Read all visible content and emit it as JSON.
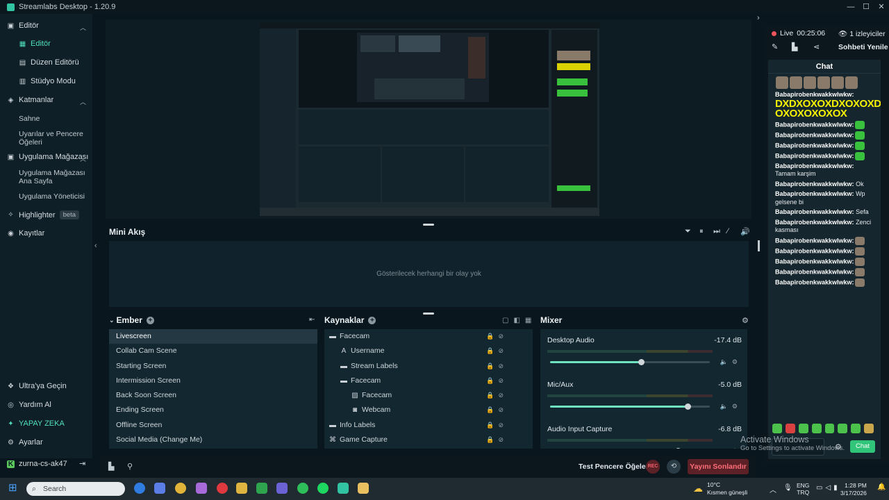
{
  "window": {
    "title": "Streamlabs Desktop - 1.20.9"
  },
  "sidebar": {
    "sections": [
      {
        "label": "Editör"
      },
      {
        "label": "Katmanlar"
      },
      {
        "label": "Uygulama Mağazası"
      }
    ],
    "items": [
      {
        "label": "Editör"
      },
      {
        "label": "Düzen Editörü"
      },
      {
        "label": "Stüdyo Modu"
      },
      {
        "label": "Sahne"
      },
      {
        "label": "Uyarılar ve Pencere Öğeleri"
      },
      {
        "label": "Uygulama Mağazası Ana Sayfa"
      },
      {
        "label": "Uygulama Yöneticisi"
      }
    ],
    "highlighter": {
      "label": "Highlighter",
      "badge": "beta"
    },
    "recordings": "Kayıtlar",
    "bottom": [
      {
        "label": "Ultra'ya Geçin"
      },
      {
        "label": "Yardım Al"
      },
      {
        "label": "YAPAY ZEKA"
      },
      {
        "label": "Ayarlar"
      }
    ],
    "user": "zurna-cs-ak47"
  },
  "mini_feed": {
    "title": "Mini Akış",
    "empty_text": "Gösterilecek herhangi bir olay yok"
  },
  "scenes": {
    "title": "Ember",
    "items": [
      "Livescreen",
      "Collab Cam Scene",
      "Starting Screen",
      "Intermission Screen",
      "Back Soon Screen",
      "Ending Screen",
      "Offline Screen",
      "Social Media (Change Me)"
    ],
    "active_index": 0
  },
  "sources": {
    "title": "Kaynaklar",
    "items": [
      {
        "label": "Facecam",
        "icon": "folder-icon",
        "indent": 0
      },
      {
        "label": "Username",
        "icon": "text-icon",
        "indent": 1
      },
      {
        "label": "Stream Labels",
        "icon": "folder-icon",
        "indent": 1
      },
      {
        "label": "Facecam",
        "icon": "folder-icon",
        "indent": 1
      },
      {
        "label": "Facecam",
        "icon": "image-icon",
        "indent": 2
      },
      {
        "label": "Webcam",
        "icon": "webcam-icon",
        "indent": 2
      },
      {
        "label": "Info Labels",
        "icon": "folder-icon",
        "indent": 0
      },
      {
        "label": "Game Capture",
        "icon": "gamepad-icon",
        "indent": 0
      }
    ]
  },
  "mixer": {
    "title": "Mixer",
    "channels": [
      {
        "name": "Desktop Audio",
        "db": "-17.4 dB",
        "level": 0.57
      },
      {
        "name": "Mic/Aux",
        "db": "-5.0 dB",
        "level": 0.86
      },
      {
        "name": "Audio Input Capture",
        "db": "-6.8 dB",
        "level": 0.8
      }
    ]
  },
  "footer": {
    "test_widgets": "Test Pencere Öğeleri",
    "rec": "REC",
    "end_stream": "Yayını Sonlandır"
  },
  "stream": {
    "live_label": "Live",
    "live_time": "00:25:06",
    "viewers": "1 izleyiciler",
    "refresh_chat": "Sohbeti Yenile"
  },
  "chat": {
    "title": "Chat",
    "messages": [
      {
        "user": "Babapirobenkwakkwlwkw:",
        "text": "DXDXOXOXDXOXOXDX OXOXOXOXOX",
        "kind": "big"
      },
      {
        "user": "Babapirobenkwakkwlwkw:",
        "text": "",
        "kind": "emote"
      },
      {
        "user": "Babapirobenkwakkwlwkw:",
        "text": "",
        "kind": "emote"
      },
      {
        "user": "Babapirobenkwakkwlwkw:",
        "text": "",
        "kind": "emote"
      },
      {
        "user": "Babapirobenkwakkwlwkw:",
        "text": "",
        "kind": "emote"
      },
      {
        "user": "Babapirobenkwakkwlwkw:",
        "text": "Tamam karşim",
        "kind": "text"
      },
      {
        "user": "Babapirobenkwakkwlwkw:",
        "text": "Ok",
        "kind": "text"
      },
      {
        "user": "Babapirobenkwakkwlwkw:",
        "text": "Wp gelsene bi",
        "kind": "text"
      },
      {
        "user": "Babapirobenkwakkwlwkw:",
        "text": "Sefa",
        "kind": "text"
      },
      {
        "user": "Babapirobenkwakkwlwkw:",
        "text": "Zenci kasması",
        "kind": "text"
      },
      {
        "user": "Babapirobenkwakkwlwkw:",
        "text": "",
        "kind": "emote"
      },
      {
        "user": "Babapirobenkwakkwlwkw:",
        "text": "",
        "kind": "emote"
      },
      {
        "user": "Babapirobenkwakkwlwkw:",
        "text": "",
        "kind": "emote"
      },
      {
        "user": "Babapirobenkwakkwlwkw:",
        "text": "",
        "kind": "emote"
      },
      {
        "user": "Babapirobenkwakkwlwkw:",
        "text": "",
        "kind": "emote"
      }
    ],
    "send_button": "Chat"
  },
  "watermark": {
    "line1": "Activate Windows",
    "line2": "Go to Settings to activate Windows."
  },
  "taskbar": {
    "search_placeholder": "Search",
    "weather_temp": "10°C",
    "weather_desc": "Kısmen güneşli",
    "lang1": "ENG",
    "lang2": "TRQ",
    "time": "1:28 PM",
    "date": "3/17/2026"
  },
  "colors": {
    "accent": "#31c3a2",
    "live_red": "#f1535c",
    "end_button": "#5c2027",
    "chat_button": "#31c57a"
  }
}
